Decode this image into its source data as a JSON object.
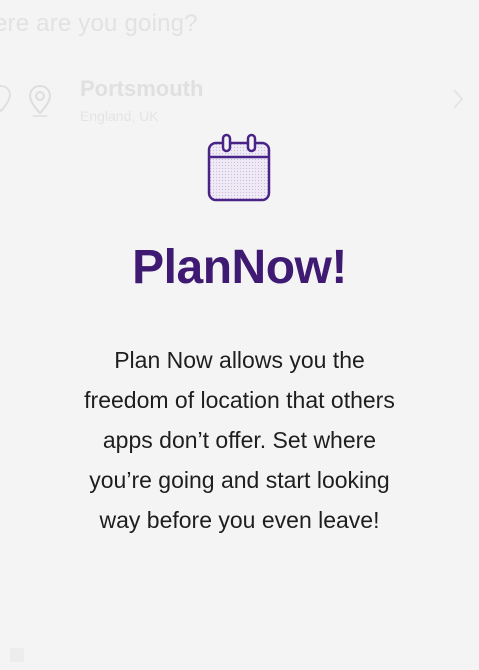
{
  "background": {
    "question": "ere are you going?",
    "location": {
      "city": "Portsmouth",
      "region": "England, UK"
    },
    "icons": {
      "left": "map-marker-icon",
      "pin": "location-pin-icon",
      "chevron": "chevron-right-icon"
    }
  },
  "onboarding": {
    "icon": "calendar-icon",
    "title": "PlanNow!",
    "description_lines": [
      "Plan Now allows you the",
      "freedom of location that others",
      "apps don’t offer. Set where",
      "you’re going and start looking",
      "way before you even leave!"
    ]
  },
  "colors": {
    "background": "#f4f4f4",
    "accent": "#3f1a73",
    "text": "#1e1e1e",
    "faded": "#e0e0e0"
  }
}
